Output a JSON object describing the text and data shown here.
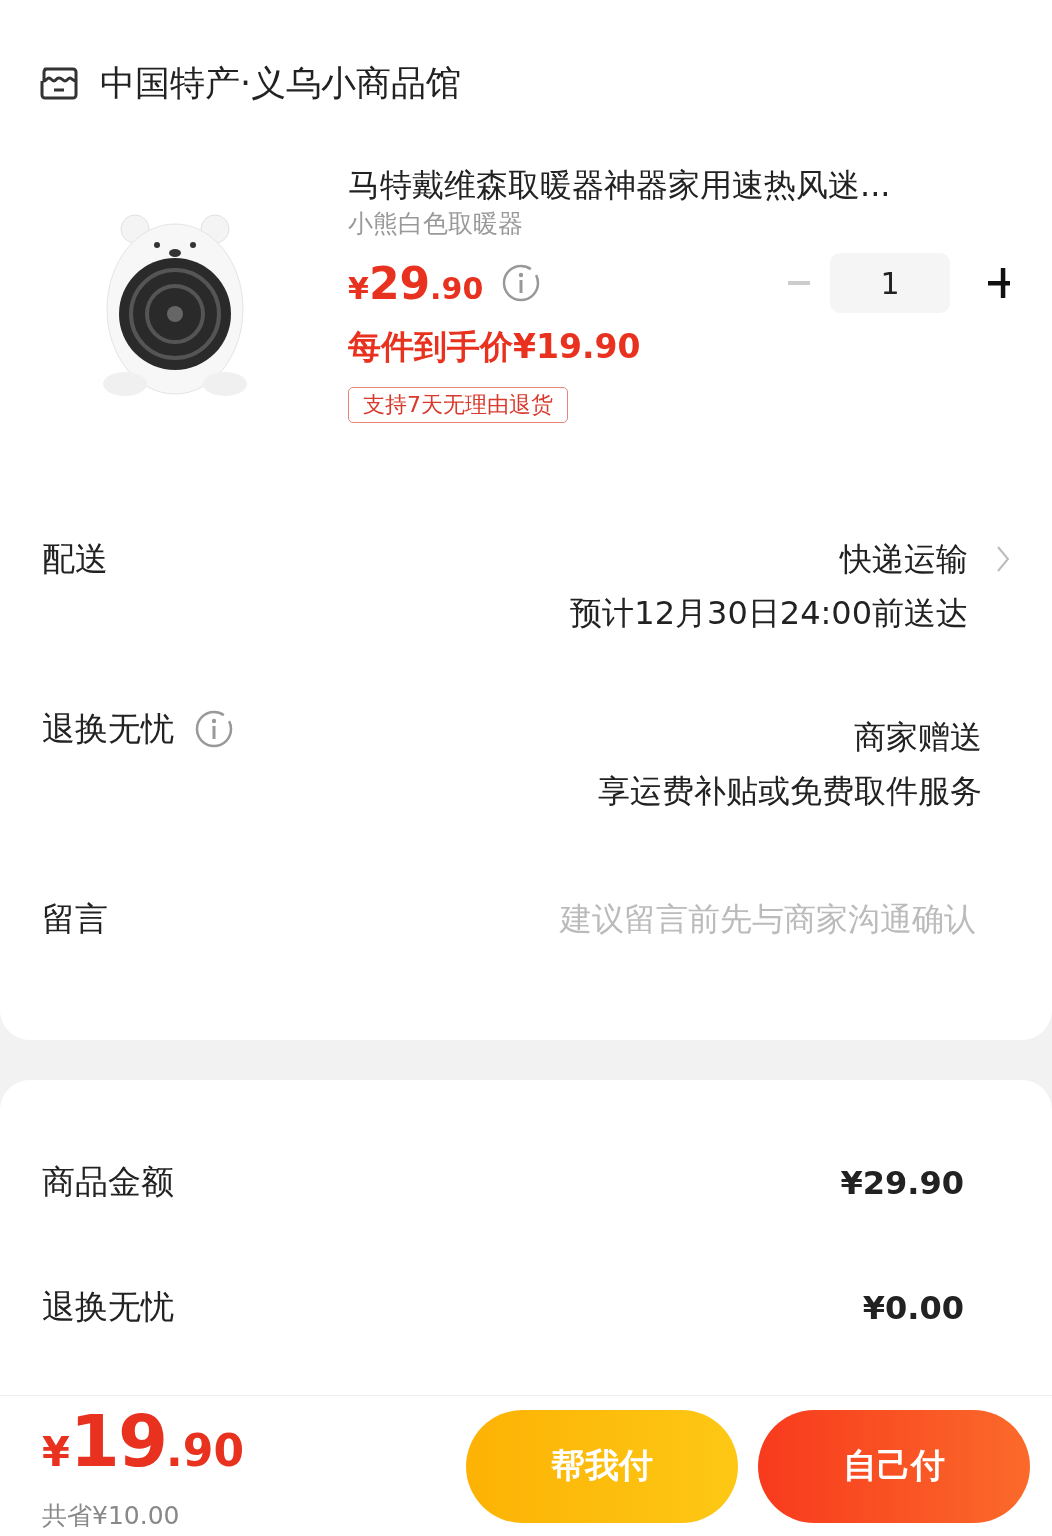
{
  "shop": {
    "name": "中国特产·义乌小商品馆"
  },
  "product": {
    "kind": "picture",
    "title": "马特戴维森取暖器神器家用速热风迷...",
    "variant": "小熊白色取暖器",
    "price": "¥29.90",
    "quantity": "1",
    "minus_disabled": true,
    "final_price": "每件到手价¥19.90",
    "tag": "支持7天无理由退货"
  },
  "delivery": {
    "label": "配送",
    "value": "快递运输",
    "detail": "预计12月30日24:00前送达"
  },
  "returns": {
    "label": "退换无忧",
    "value": "商家赠送",
    "detail": "享运费补贴或免费取件服务"
  },
  "message": {
    "label": "留言",
    "placeholder": "建议留言前先与商家沟通确认"
  },
  "summary": [
    {
      "label": "商品金额",
      "value": "¥29.90"
    },
    {
      "label": "退换无忧",
      "value": "¥0.00"
    }
  ],
  "footer": {
    "total": "¥19.90",
    "saved": "共省¥10.00",
    "buttons": [
      {
        "label": "帮我付",
        "kind": "secondary"
      },
      {
        "label": "自己付",
        "kind": "primary"
      }
    ]
  }
}
